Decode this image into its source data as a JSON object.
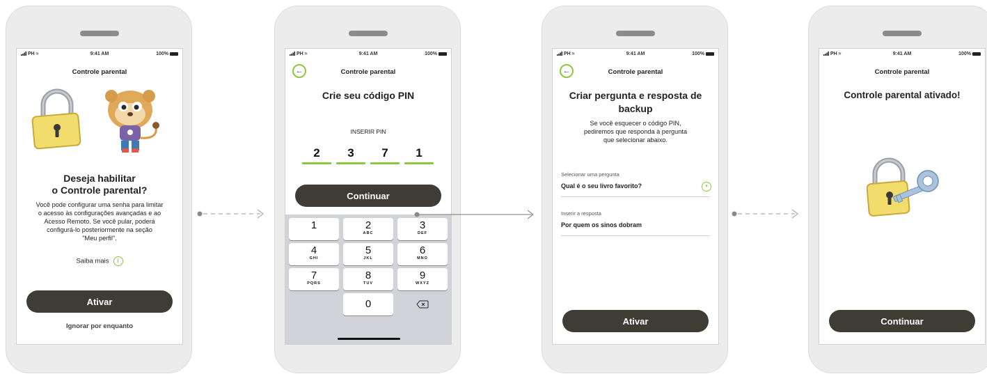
{
  "status_bar": {
    "carrier": "PH",
    "time": "9:41 AM",
    "battery": "100%"
  },
  "screens": [
    {
      "title": "Controle parental",
      "heading": "Deseja habilitar o Controle parental?",
      "heading_line1": "Deseja habilitar",
      "heading_line2": "o Controle parental?",
      "description_lines": [
        "Você pode configurar uma senha para limitar",
        "o acesso às configurações avançadas e ao",
        "Acesso Remoto. Se você pular, poderá",
        "configurá-lo posteriormente na seção",
        "\"Meu perfil\"."
      ],
      "learn_more": "Saiba mais",
      "button": "Ativar",
      "secondary_link": "Ignorar por enquanto"
    },
    {
      "title": "Controle parental",
      "heading": "Crie seu código PIN",
      "pin_label": "INSERIR PIN",
      "pin_digits": [
        "2",
        "3",
        "7",
        "1"
      ],
      "button": "Continuar",
      "keypad": [
        {
          "n": "1",
          "s": ""
        },
        {
          "n": "2",
          "s": "ABC"
        },
        {
          "n": "3",
          "s": "DEF"
        },
        {
          "n": "4",
          "s": "GHI"
        },
        {
          "n": "5",
          "s": "JKL"
        },
        {
          "n": "6",
          "s": "MNO"
        },
        {
          "n": "7",
          "s": "PQRS"
        },
        {
          "n": "8",
          "s": "TUV"
        },
        {
          "n": "9",
          "s": "WXYZ"
        },
        {
          "n": "0",
          "s": ""
        }
      ]
    },
    {
      "title": "Controle parental",
      "heading_line1": "Criar pergunta e resposta de",
      "heading_line2": "backup",
      "description_lines": [
        "Se você esquecer o código PIN,",
        "pediremos que responda à pergunta",
        "que selecionar abaixo."
      ],
      "question_label": "Selecionar uma pergunta",
      "question_value": "Qual é o seu livro favorito?",
      "answer_label": "Inserir a resposta",
      "answer_value": "Por quem os sinos dobram",
      "button": "Ativar"
    },
    {
      "title": "Controle parental",
      "heading": "Controle parental ativado!",
      "button": "Continuar"
    }
  ],
  "colors": {
    "accent": "#8ec63f",
    "button": "#3f3b35",
    "lock": "#f2dc6b"
  }
}
